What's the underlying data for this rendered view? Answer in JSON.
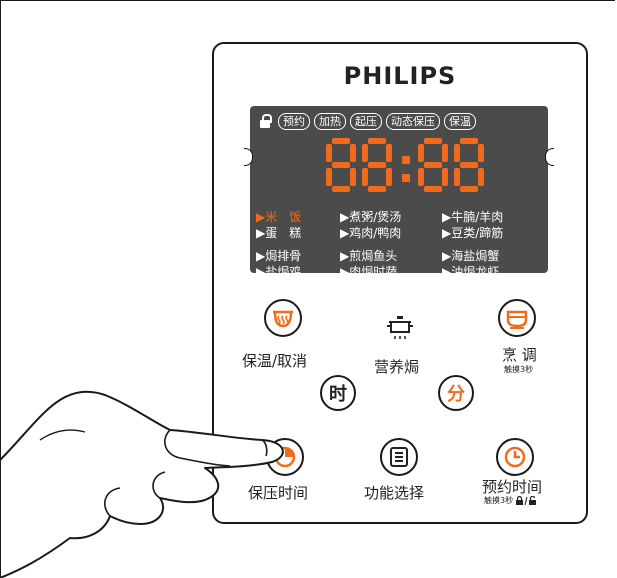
{
  "brand": "PHILIPS",
  "accent_color": "#f26b1d",
  "display_bg": "#4b4b4b",
  "display": {
    "time": "88:88",
    "indicators": [
      "预约",
      "加热",
      "起压",
      "动态保压",
      "保温"
    ],
    "lock_icon": "lock-icon",
    "menu_rows": [
      [
        "▶米　饭",
        "▶煮粥/煲汤",
        "▶牛腩/羊肉"
      ],
      [
        "▶蛋　糕",
        "▶鸡肉/鸭肉",
        "▶豆类/蹄筋"
      ],
      [
        "▶焗排骨",
        "▶煎焗鱼头",
        "▶海盐焗蟹"
      ],
      [
        "▶盐焗鸡",
        "▶肉焗时蔬",
        "▶油焗龙虾"
      ]
    ],
    "active_item": "▶米　饭"
  },
  "buttons": {
    "keep_warm": {
      "label": "保温/取消",
      "icon": "warm-steam-icon"
    },
    "nutrition": {
      "label": "营养焗",
      "icon": "pot-icon"
    },
    "cook": {
      "label": "烹 调",
      "sub": "触摸3秒",
      "icon": "cook-pot-icon"
    },
    "hour": {
      "char": "时"
    },
    "minute": {
      "char": "分"
    },
    "pressure_time": {
      "label": "保压时间",
      "icon": "pressure-timer-icon"
    },
    "function": {
      "label": "功能选择",
      "icon": "menu-list-icon"
    },
    "schedule": {
      "label": "预约时间",
      "sub": "触摸3秒",
      "icon": "clock-icon"
    }
  }
}
